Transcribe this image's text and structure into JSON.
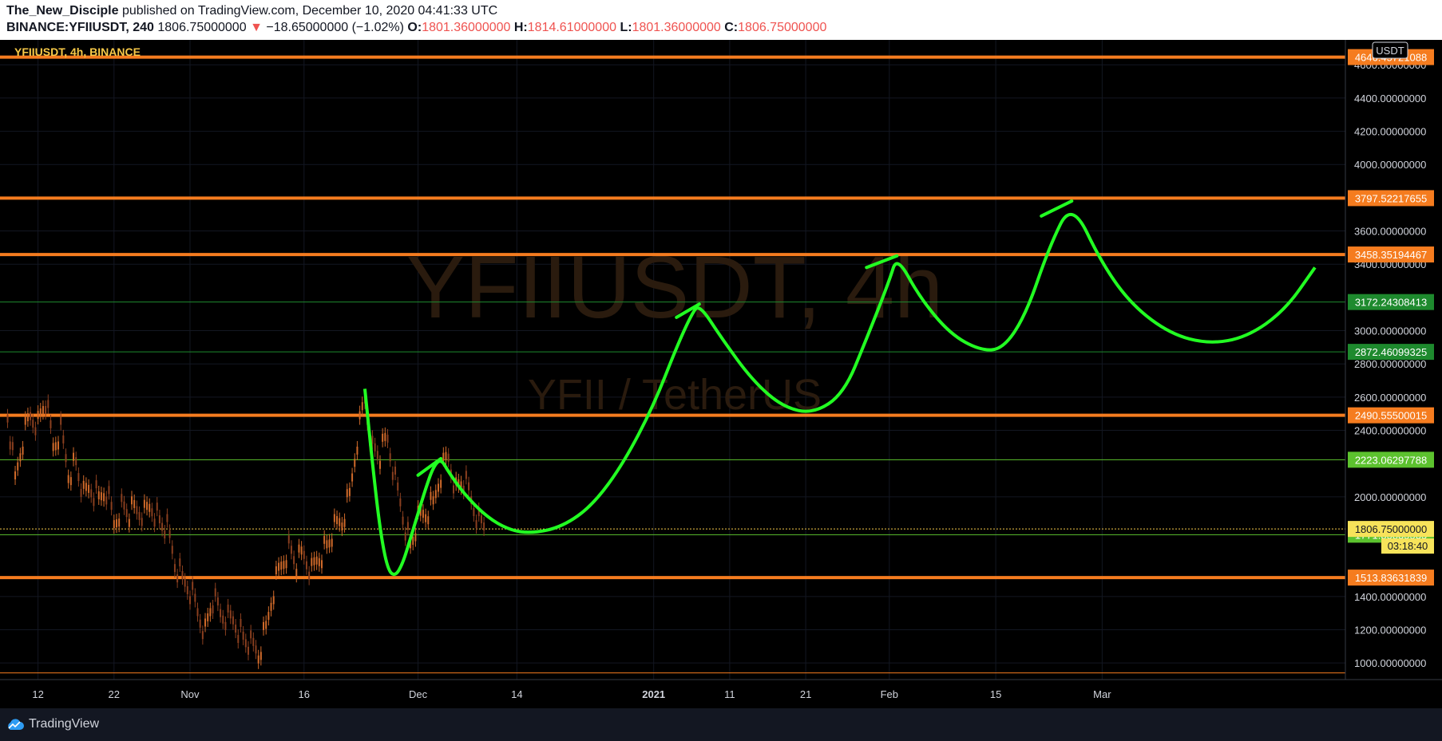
{
  "header": {
    "author": "The_New_Disciple",
    "published_text": "published on TradingView.com, December 10, 2020 04:41:33 UTC",
    "symbol": "BINANCE:YFIIUSDT, 240",
    "last": "1806.75000000",
    "change_arrow": "▼",
    "change": "−18.65000000 (−1.02%)",
    "o_label": "O:",
    "o_value": "1801.36000000",
    "h_label": "H:",
    "h_value": "1814.61000000",
    "l_label": "L:",
    "l_value": "1801.36000000",
    "c_label": "C:",
    "c_value": "1806.75000000"
  },
  "chart_data": {
    "type": "line",
    "legend_text": "YFIIUSDT, 4h, BINANCE",
    "watermark_main": "YFIIUSDT, 4h",
    "watermark_sub": "YFII / TetherUS",
    "currency": "USDT",
    "y_range": [
      900,
      4750
    ],
    "y_ticks": [
      "1000.00000000",
      "1200.00000000",
      "1400.00000000",
      "2000.00000000",
      "2400.00000000",
      "2600.00000000",
      "2800.00000000",
      "3000.00000000",
      "3400.00000000",
      "3600.00000000",
      "4000.00000000",
      "4200.00000000",
      "4400.00000000",
      "4600.00000000"
    ],
    "x_ticks": [
      {
        "label": "12",
        "date": "2020-10-12"
      },
      {
        "label": "22",
        "date": "2020-10-22"
      },
      {
        "label": "Nov",
        "date": "2020-11-01"
      },
      {
        "label": "16",
        "date": "2020-11-16"
      },
      {
        "label": "Dec",
        "date": "2020-12-01"
      },
      {
        "label": "14",
        "date": "2020-12-14"
      },
      {
        "label": "2021",
        "date": "2021-01-01"
      },
      {
        "label": "11",
        "date": "2021-01-11"
      },
      {
        "label": "21",
        "date": "2021-01-21"
      },
      {
        "label": "Feb",
        "date": "2021-02-01"
      },
      {
        "label": "15",
        "date": "2021-02-15"
      },
      {
        "label": "Mar",
        "date": "2021-03-01"
      }
    ],
    "levels": [
      {
        "price": 4646.45,
        "label": "4646.45721088",
        "color": "#f57c1f",
        "width": 4
      },
      {
        "price": 3797.52217655,
        "label": "3797.52217655",
        "color": "#f57c1f",
        "width": 4
      },
      {
        "price": 3458.35194467,
        "label": "3458.35194467",
        "color": "#f57c1f",
        "width": 4
      },
      {
        "price": 3172.24308413,
        "label": "3172.24308413",
        "color": "#1e8a2e",
        "width": 1
      },
      {
        "price": 2872.46099325,
        "label": "2872.46099325",
        "color": "#1e8a2e",
        "width": 1
      },
      {
        "price": 2490.55500015,
        "label": "2490.55500015",
        "color": "#f57c1f",
        "width": 4
      },
      {
        "price": 2223.06297788,
        "label": "2223.06297788",
        "color": "#5cc22e",
        "width": 1
      },
      {
        "price": 1771.85835535,
        "label": "1771.85835535",
        "color": "#5cc22e",
        "width": 1
      },
      {
        "price": 1513.83631839,
        "label": "1513.83631839",
        "color": "#f57c1f",
        "width": 4
      },
      {
        "price": 940,
        "label": "",
        "color": "#f57c1f",
        "width": 1
      }
    ],
    "last_price": {
      "price": 1806.75,
      "label": "1806.75000000",
      "countdown": "03:18:40"
    },
    "price_closes": [
      {
        "date": "2020-10-08",
        "price": 2500
      },
      {
        "date": "2020-10-09",
        "price": 2100
      },
      {
        "date": "2020-10-10",
        "price": 2350
      },
      {
        "date": "2020-10-11",
        "price": 2500
      },
      {
        "date": "2020-10-12",
        "price": 2450
      },
      {
        "date": "2020-10-13",
        "price": 2580
      },
      {
        "date": "2020-10-14",
        "price": 2300
      },
      {
        "date": "2020-10-15",
        "price": 2400
      },
      {
        "date": "2020-10-16",
        "price": 2150
      },
      {
        "date": "2020-10-17",
        "price": 2200
      },
      {
        "date": "2020-10-18",
        "price": 2000
      },
      {
        "date": "2020-10-19",
        "price": 2050
      },
      {
        "date": "2020-10-20",
        "price": 1980
      },
      {
        "date": "2020-10-21",
        "price": 2050
      },
      {
        "date": "2020-10-22",
        "price": 1850
      },
      {
        "date": "2020-10-23",
        "price": 1950
      },
      {
        "date": "2020-10-24",
        "price": 1900
      },
      {
        "date": "2020-10-25",
        "price": 1920
      },
      {
        "date": "2020-10-26",
        "price": 1900
      },
      {
        "date": "2020-10-27",
        "price": 1950
      },
      {
        "date": "2020-10-28",
        "price": 1850
      },
      {
        "date": "2020-10-29",
        "price": 1800
      },
      {
        "date": "2020-10-30",
        "price": 1600
      },
      {
        "date": "2020-10-31",
        "price": 1500
      },
      {
        "date": "2020-11-01",
        "price": 1450
      },
      {
        "date": "2020-11-02",
        "price": 1320
      },
      {
        "date": "2020-11-03",
        "price": 1200
      },
      {
        "date": "2020-11-04",
        "price": 1380
      },
      {
        "date": "2020-11-05",
        "price": 1300
      },
      {
        "date": "2020-11-06",
        "price": 1270
      },
      {
        "date": "2020-11-07",
        "price": 1250
      },
      {
        "date": "2020-11-08",
        "price": 1150
      },
      {
        "date": "2020-11-09",
        "price": 1100
      },
      {
        "date": "2020-11-10",
        "price": 1050
      },
      {
        "date": "2020-11-11",
        "price": 1200
      },
      {
        "date": "2020-11-12",
        "price": 1450
      },
      {
        "date": "2020-11-13",
        "price": 1600
      },
      {
        "date": "2020-11-14",
        "price": 1700
      },
      {
        "date": "2020-11-15",
        "price": 1600
      },
      {
        "date": "2020-11-16",
        "price": 1650
      },
      {
        "date": "2020-11-17",
        "price": 1550
      },
      {
        "date": "2020-11-18",
        "price": 1650
      },
      {
        "date": "2020-11-19",
        "price": 1700
      },
      {
        "date": "2020-11-20",
        "price": 1800
      },
      {
        "date": "2020-11-21",
        "price": 1850
      },
      {
        "date": "2020-11-22",
        "price": 2000
      },
      {
        "date": "2020-11-23",
        "price": 2350
      },
      {
        "date": "2020-11-24",
        "price": 2600
      },
      {
        "date": "2020-11-25",
        "price": 2300
      },
      {
        "date": "2020-11-26",
        "price": 2250
      },
      {
        "date": "2020-11-27",
        "price": 2350
      },
      {
        "date": "2020-11-28",
        "price": 2100
      },
      {
        "date": "2020-11-29",
        "price": 1900
      },
      {
        "date": "2020-11-30",
        "price": 1700
      },
      {
        "date": "2020-12-01",
        "price": 1850
      },
      {
        "date": "2020-12-02",
        "price": 1900
      },
      {
        "date": "2020-12-03",
        "price": 1950
      },
      {
        "date": "2020-12-04",
        "price": 2150
      },
      {
        "date": "2020-12-05",
        "price": 2250
      },
      {
        "date": "2020-12-06",
        "price": 2050
      },
      {
        "date": "2020-12-07",
        "price": 2100
      },
      {
        "date": "2020-12-08",
        "price": 1980
      },
      {
        "date": "2020-12-09",
        "price": 1850
      },
      {
        "date": "2020-12-10",
        "price": 1807
      }
    ],
    "projection": [
      {
        "date": "2020-11-24",
        "price": 2650
      },
      {
        "date": "2020-11-25",
        "price": 2200
      },
      {
        "date": "2020-11-26",
        "price": 1800
      },
      {
        "date": "2020-11-27",
        "price": 1560
      },
      {
        "date": "2020-11-28",
        "price": 1520
      },
      {
        "date": "2020-11-29",
        "price": 1600
      },
      {
        "date": "2020-11-30",
        "price": 1750
      },
      {
        "date": "2020-12-01",
        "price": 1900
      },
      {
        "date": "2020-12-02",
        "price": 2050
      },
      {
        "date": "2020-12-03",
        "price": 2180
      },
      {
        "date": "2020-12-04",
        "price": 2230
      },
      {
        "date": "2020-12-05",
        "price": 2150
      },
      {
        "date": "2020-12-07",
        "price": 2020
      },
      {
        "date": "2020-12-10",
        "price": 1880
      },
      {
        "date": "2020-12-13",
        "price": 1800
      },
      {
        "date": "2020-12-16",
        "price": 1780
      },
      {
        "date": "2020-12-20",
        "price": 1820
      },
      {
        "date": "2020-12-24",
        "price": 1950
      },
      {
        "date": "2020-12-28",
        "price": 2200
      },
      {
        "date": "2021-01-01",
        "price": 2550
      },
      {
        "date": "2021-01-04",
        "price": 2900
      },
      {
        "date": "2021-01-06",
        "price": 3100
      },
      {
        "date": "2021-01-07",
        "price": 3160
      },
      {
        "date": "2021-01-10",
        "price": 2950
      },
      {
        "date": "2021-01-14",
        "price": 2700
      },
      {
        "date": "2021-01-18",
        "price": 2540
      },
      {
        "date": "2021-01-22",
        "price": 2500
      },
      {
        "date": "2021-01-26",
        "price": 2620
      },
      {
        "date": "2021-01-29",
        "price": 2950
      },
      {
        "date": "2021-02-01",
        "price": 3300
      },
      {
        "date": "2021-02-02",
        "price": 3450
      },
      {
        "date": "2021-02-05",
        "price": 3200
      },
      {
        "date": "2021-02-09",
        "price": 2980
      },
      {
        "date": "2021-02-13",
        "price": 2880
      },
      {
        "date": "2021-02-16",
        "price": 2890
      },
      {
        "date": "2021-02-19",
        "price": 3100
      },
      {
        "date": "2021-02-22",
        "price": 3500
      },
      {
        "date": "2021-02-25",
        "price": 3780
      },
      {
        "date": "2021-03-01",
        "price": 3400
      },
      {
        "date": "2021-03-05",
        "price": 3150
      },
      {
        "date": "2021-03-10",
        "price": 2980
      },
      {
        "date": "2021-03-15",
        "price": 2920
      },
      {
        "date": "2021-03-20",
        "price": 2960
      },
      {
        "date": "2021-03-25",
        "price": 3120
      },
      {
        "date": "2021-03-29",
        "price": 3380
      }
    ],
    "peak_ticks": [
      {
        "from": {
          "date": "2020-12-01",
          "price": 2130
        },
        "to": {
          "date": "2020-12-04",
          "price": 2230
        }
      },
      {
        "from": {
          "date": "2021-01-04",
          "price": 3080
        },
        "to": {
          "date": "2021-01-07",
          "price": 3160
        }
      },
      {
        "from": {
          "date": "2021-01-29",
          "price": 3380
        },
        "to": {
          "date": "2021-02-02",
          "price": 3450
        }
      },
      {
        "from": {
          "date": "2021-02-21",
          "price": 3690
        },
        "to": {
          "date": "2021-02-25",
          "price": 3780
        }
      }
    ],
    "projection_color": "#22ff22"
  },
  "footer": {
    "brand": "TradingView"
  }
}
